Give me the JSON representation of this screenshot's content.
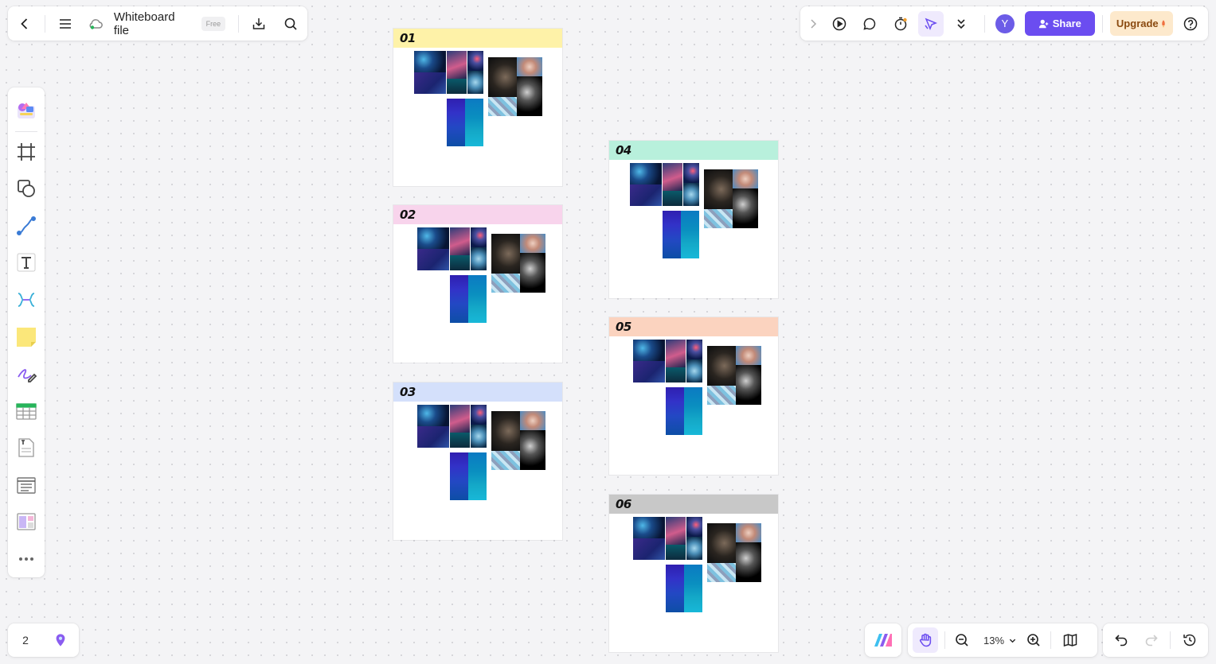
{
  "top_left": {
    "file_title": "Whiteboard file",
    "plan_badge": "Free"
  },
  "top_right": {
    "avatar_initial": "Y",
    "share_label": "Share",
    "upgrade_label": "Upgrade"
  },
  "left_toolbar": {
    "tools": [
      "template-icon",
      "frame-icon",
      "shape-icon",
      "connector-icon",
      "text-icon",
      "mindmap-icon",
      "sticky-note-icon",
      "pen-icon",
      "table-icon",
      "document-icon",
      "list-icon",
      "layout-icon",
      "more-icon"
    ]
  },
  "bottom_left": {
    "page_count": "2"
  },
  "zoom": {
    "level": "13%"
  },
  "frames": [
    {
      "label": "01",
      "header_color": "#fef2a8"
    },
    {
      "label": "02",
      "header_color": "#f8d4ec"
    },
    {
      "label": "03",
      "header_color": "#d4e0fb"
    },
    {
      "label": "04",
      "header_color": "#b8f0dc"
    },
    {
      "label": "05",
      "header_color": "#fbd3bf"
    },
    {
      "label": "06",
      "header_color": "#c8c8c8"
    }
  ],
  "colors": {
    "accent": "#6b4df0",
    "upgrade_bg": "#fde9cc"
  }
}
